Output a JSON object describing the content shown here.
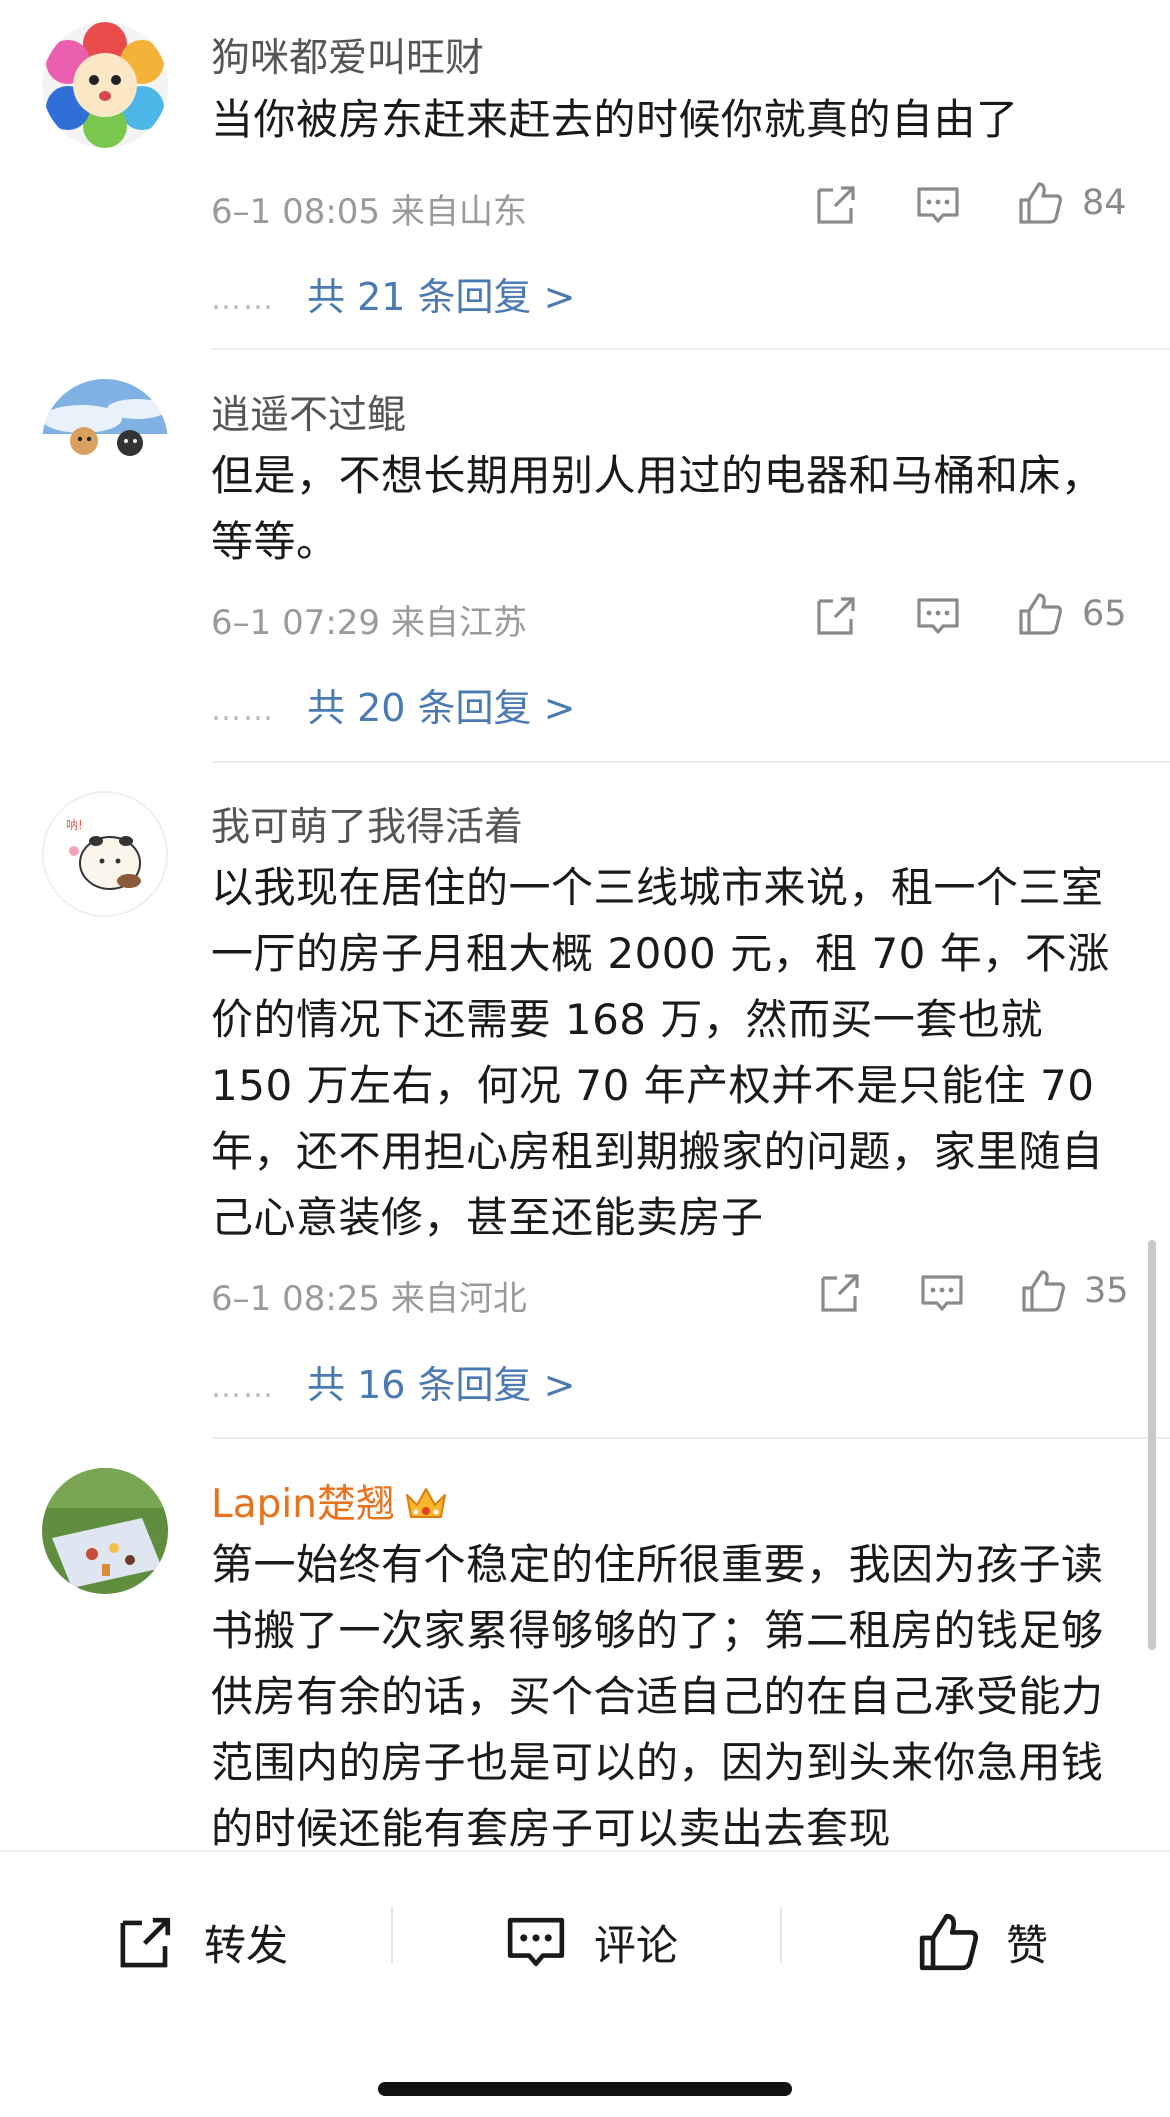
{
  "comments": [
    {
      "username": "狗咪都爱叫旺财",
      "text": "当你被房东赶来赶去的时候你就真的自由了",
      "meta": "6–1 08:05  来自山东",
      "likes": "84",
      "replies": "共 21 条回复 >"
    },
    {
      "username": "逍遥不过鲲",
      "text": "但是，不想长期用别人用过的电器和马桶和床，等等。",
      "meta": "6–1 07:29  来自江苏",
      "likes": "65",
      "replies": "共 20 条回复 >"
    },
    {
      "username": "我可萌了我得活着",
      "text": "以我现在居住的一个三线城市来说，租一个三室一厅的房子月租大概 2000 元，租 70 年，不涨价的情况下还需要 168 万，然而买一套也就 150 万左右，何况 70 年产权并不是只能住 70 年，还不用担心房租到期搬家的问题，家里随自己心意装修，甚至还能卖房子",
      "meta": "6–1 08:25  来自河北",
      "likes": "35",
      "replies": "共 16 条回复 >"
    },
    {
      "username": "Lapin楚翘",
      "text": "第一始终有个稳定的住所很重要，我因为孩子读书搬了一次家累得够够的了；第二租房的钱足够供房有余的话，买个合适自己的在自己承受能力范围内的房子也是可以的，因为到头来你急用钱的时候还能有套房子可以卖出去套现"
    }
  ],
  "reply_dots": "……",
  "bottom_bar": {
    "repost": "转发",
    "comment": "评论",
    "like": "赞"
  },
  "colors": {
    "link_blue": "#4a7ab3",
    "vip_orange": "#e8731c",
    "meta_gray": "#9a9a9a"
  }
}
